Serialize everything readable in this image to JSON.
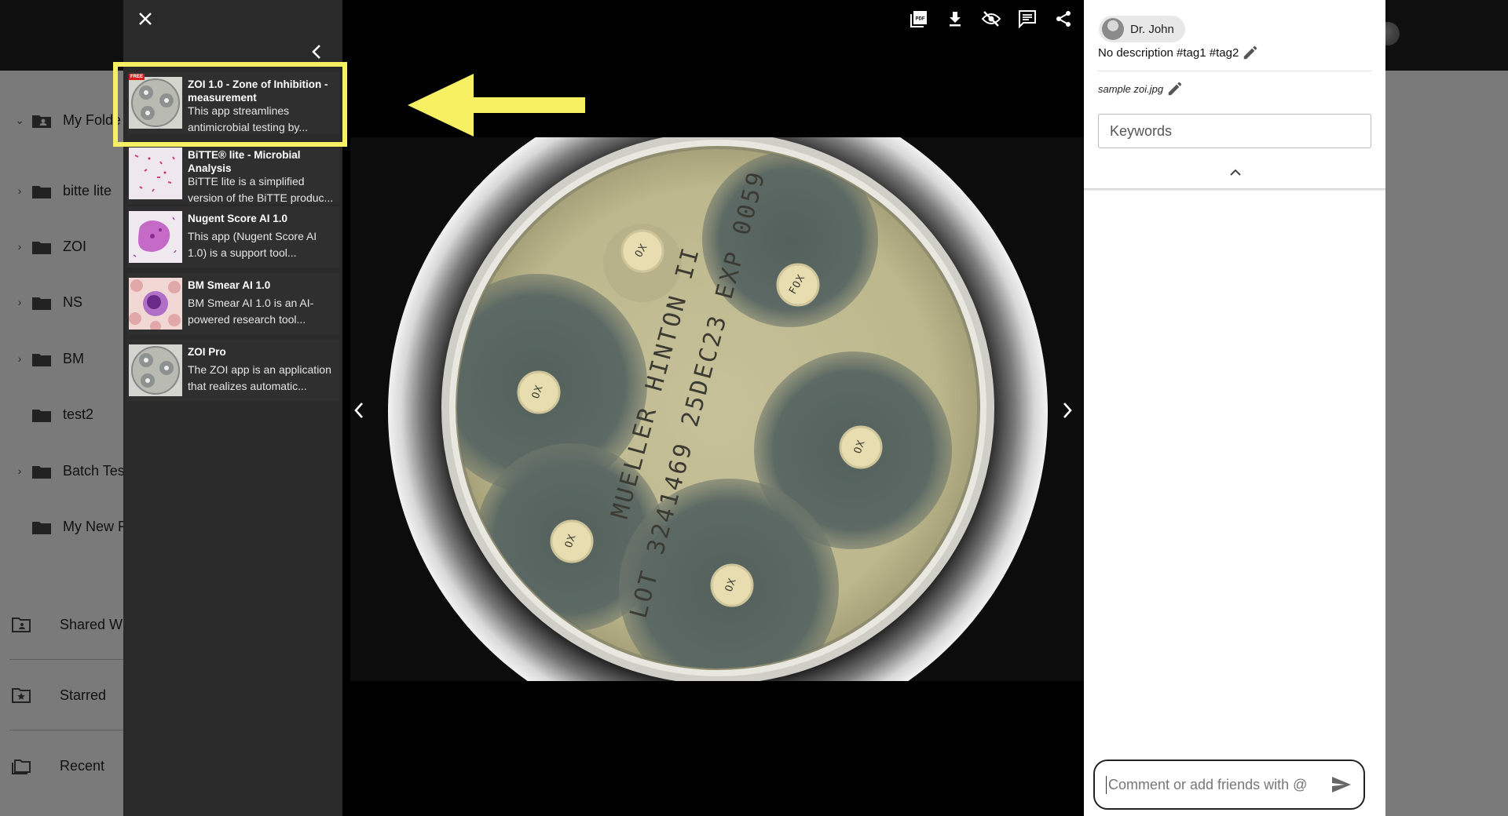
{
  "background_app": {
    "folders": [
      {
        "label": "My Folde",
        "has_chevron": true,
        "expanded": true
      },
      {
        "label": "bitte lite",
        "has_chevron": true
      },
      {
        "label": "ZOI",
        "has_chevron": true
      },
      {
        "label": "NS",
        "has_chevron": true
      },
      {
        "label": "BM",
        "has_chevron": true
      },
      {
        "label": "test2",
        "has_chevron": false
      },
      {
        "label": "Batch Tes",
        "has_chevron": true
      },
      {
        "label": "My New F",
        "has_chevron": false
      }
    ],
    "nav": [
      {
        "label": "Shared Wi",
        "icon": "shared-folder-icon"
      },
      {
        "label": "Starred",
        "icon": "starred-folder-icon"
      },
      {
        "label": "Recent",
        "icon": "recent-folder-icon"
      }
    ]
  },
  "app_panel": {
    "close_icon": "close-icon",
    "collapse_icon": "chevron-left-icon",
    "apps": [
      {
        "title": "ZOI 1.0 - Zone of Inhibition - measurement",
        "desc_line1": "This app streamlines",
        "desc_line2": "antimicrobial testing by...",
        "badge": "FREE",
        "thumb": "petri-dish",
        "highlighted": true
      },
      {
        "title": "BiTTE® lite - Microbial Analysis",
        "desc_line1": "BiTTE lite is a simplified",
        "desc_line2": "version of the BiTTE produc...",
        "thumb": "gram-stain"
      },
      {
        "title": "Nugent Score AI 1.0",
        "desc_line1": "This app (Nugent Score AI",
        "desc_line2": "1.0) is a support tool...",
        "thumb": "purple-cells"
      },
      {
        "title": "BM Smear AI 1.0",
        "desc_line1": "BM Smear AI 1.0 is an AI-",
        "desc_line2": "powered research tool...",
        "thumb": "blood-smear"
      },
      {
        "title": "ZOI Pro",
        "desc_line1": "The ZOI app is an application",
        "desc_line2": "that realizes automatic...",
        "thumb": "petri-dish"
      }
    ]
  },
  "viewer": {
    "toolbar": [
      {
        "name": "pdf-icon"
      },
      {
        "name": "download-icon"
      },
      {
        "name": "visibility-off-icon"
      },
      {
        "name": "comment-icon"
      },
      {
        "name": "share-icon"
      }
    ],
    "plate_label_line1": "MUELLER HINTON II",
    "plate_label_line2": "LOT 3241469 25DEC23 EXP 0059",
    "discs": [
      {
        "label": "OX"
      },
      {
        "label": "FOX"
      },
      {
        "label": "OX"
      },
      {
        "label": "OX"
      },
      {
        "label": "OX"
      },
      {
        "label": "OX"
      }
    ]
  },
  "info_panel": {
    "user_name": "Dr. John",
    "description": "No description #tag1 #tag2",
    "file_name": "sample zoi.jpg",
    "keywords_placeholder": "Keywords",
    "comment_placeholder": "Comment or add friends with @"
  },
  "colors": {
    "highlight": "#f7f063",
    "panel_bg": "#2a2a2a",
    "viewer_bg": "#000000"
  }
}
